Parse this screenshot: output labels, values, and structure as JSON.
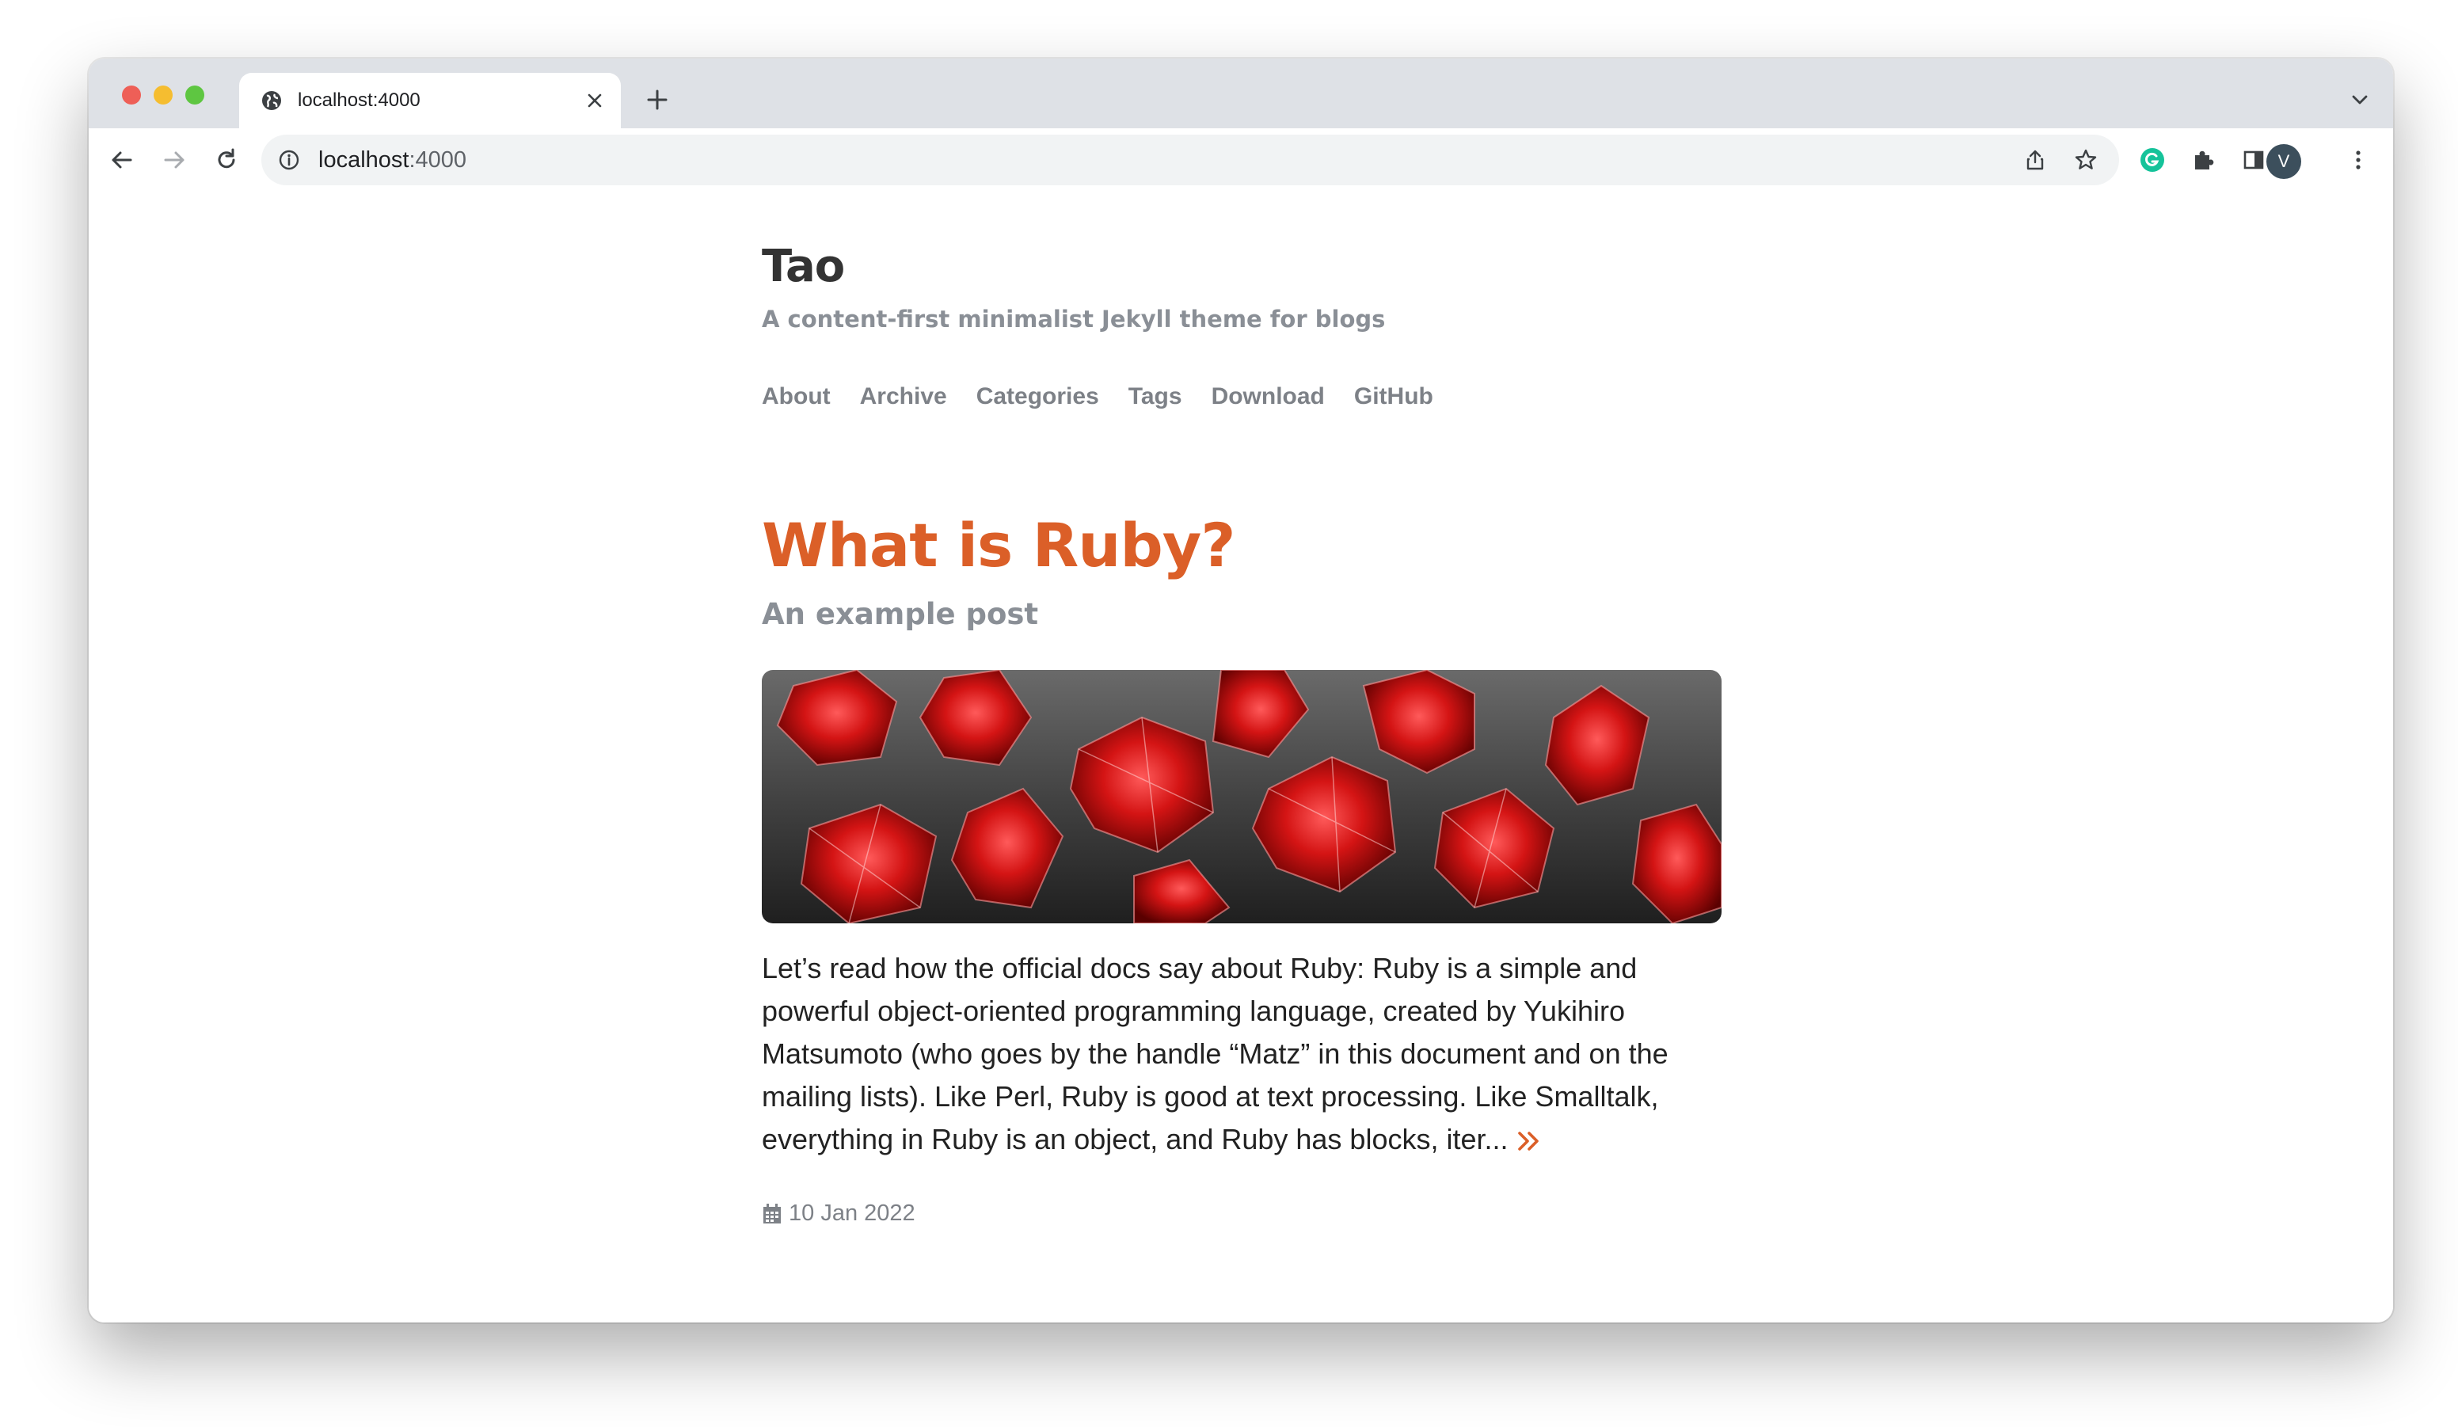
{
  "browser": {
    "tab": {
      "title": "localhost:4000",
      "favicon": "globe-icon"
    },
    "address": {
      "host": "localhost",
      "port": ":4000"
    },
    "profile_initial": "V",
    "colors": {
      "tabbar": "#dee1e6",
      "omnibox": "#f1f3f4",
      "grammarly": "#15c39a",
      "avatar": "#3c4f5c"
    }
  },
  "site": {
    "title": "Tao",
    "description": "A content-first minimalist Jekyll theme for blogs",
    "nav": [
      {
        "label": "About"
      },
      {
        "label": "Archive"
      },
      {
        "label": "Categories"
      },
      {
        "label": "Tags"
      },
      {
        "label": "Download"
      },
      {
        "label": "GitHub"
      }
    ],
    "accent_color": "#db5f28"
  },
  "post": {
    "title": "What is Ruby?",
    "subtitle": "An example post",
    "image": "red-gemstones",
    "excerpt": "Let’s read how the official docs say about Ruby: Ruby is a simple and powerful object-oriented programming language, created by Yukihiro Matsumoto (who goes by the handle “Matz” in this document and on the mailing lists). Like Perl, Ruby is good at text processing. Like Smalltalk, everything in Ruby is an object, and Ruby has blocks, iter...",
    "date": "10 Jan 2022",
    "read_more_icon": "double-chevron-right-icon",
    "date_icon": "calendar-icon"
  }
}
